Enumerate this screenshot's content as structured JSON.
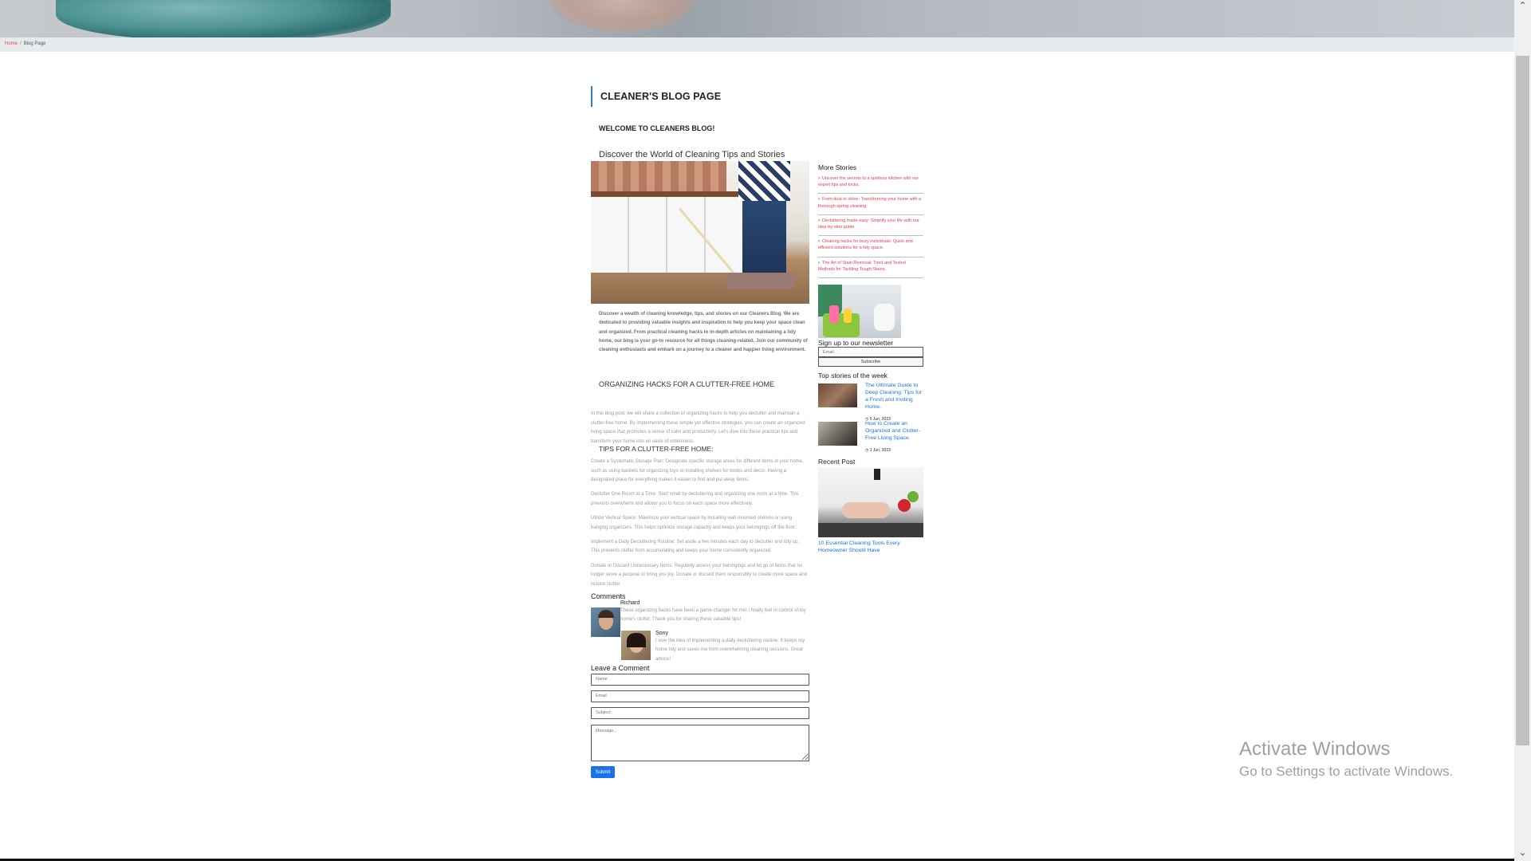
{
  "breadcrumb": {
    "home": "Home",
    "separator": "/",
    "current": "Blog Page"
  },
  "main": {
    "page_title": "CLEANER'S BLOG PAGE",
    "welcome": "WELCOME TO CLEANERS BLOG!",
    "discover": "Discover the World of Cleaning Tips and Stories",
    "intro": "Discover a wealth of cleaning knowledge, tips, and stories on our Cleaners Blog. We are dedicated to providing valuable insights and inspiration to help you keep your space clean and organized. From practical cleaning hacks to in-depth articles on maintaining a tidy home, our blog is your go-to resource for all things cleaning-related. Join our community of cleaning enthusiasts and embark on a journey to a cleaner and happier living environment.",
    "section_title": "ORGANIZING HACKS FOR A CLUTTER-FREE HOME",
    "post_intro": "In this blog post, we will share a collection of organizing hacks to help you declutter and maintain a clutter-free home. By implementing these simple yet effective strategies, you can create an organized living space that promotes a sense of calm and productivity. Let's dive into these practical tips and transform your home into an oasis of orderliness.",
    "tips_title": "TIPS FOR A CLUTTER-FREE HOME:",
    "tips": [
      "Create a Systematic Storage Plan: Designate specific storage areas for different items in your home, such as using baskets for organizing toys or installing shelves for books and decor. Having a designated place for everything makes it easier to find and put away items.",
      "Declutter One Room at a Time: Start small by decluttering and organizing one room at a time. This prevents overwhelm and allows you to focus on each space more effectively.",
      "Utilize Vertical Space: Maximize your vertical space by installing wall-mounted shelves or using hanging organizers. This helps optimize storage capacity and keeps your belongings off the floor.",
      "Implement a Daily Decluttering Routine: Set aside a few minutes each day to declutter and tidy up. This prevents clutter from accumulating and keeps your home consistently organized.",
      "Donate or Discard Unnecessary Items: Regularly assess your belongings and let go of items that no longer serve a purpose or bring you joy. Donate or discard them responsibly to create more space and reduce clutter."
    ],
    "comments_title": "Comments",
    "comments": [
      {
        "name": "Richard",
        "text": "These organizing hacks have been a game-changer for me! I finally feel in control of my home's clutter. Thank you for sharing these valuable tips!"
      },
      {
        "name": "Sony",
        "text": "I love the idea of implementing a daily decluttering routine. It keeps my home tidy and saves me from overwhelming cleaning sessions. Great advice!"
      }
    ],
    "leave_comment_title": "Leave a Comment",
    "form": {
      "name_placeholder": "Name",
      "email_placeholder": "Email",
      "subject_placeholder": "Subject",
      "message_placeholder": "Message...",
      "submit_label": "Submit"
    }
  },
  "sidebar": {
    "more_stories_title": "More Stories",
    "stories": [
      "Uncover the secrets to a spotless kitchen with our expert tips and tricks.",
      "From dust to shine: Transforming your home with a thorough spring cleaning.",
      "Decluttering made easy: Simplify your life with our step-by-step guide.",
      "Cleaning hacks for busy individuals: Quick and efficient solutions for a tidy space.",
      "The Art of Stain Removal: Tried and Tested Methods for Tackling Tough Stains."
    ],
    "newsletter_title": "Sign up to our newsletter",
    "newsletter_placeholder": "Email",
    "subscribe_label": "Subscribe",
    "top_stories_title": "Top stories of the week",
    "top_stories": [
      {
        "title": "The Ultimate Guide to Deep Cleaning: Tips for a Fresh and Inviting Home.",
        "date": "5 Jun, 2023"
      },
      {
        "title": "How to Create an Organized and Clutter-Free Living Space.",
        "date": "1 Jun, 2023"
      }
    ],
    "recent_post_title": "Recent Post",
    "recent_post": "10 Essential Cleaning Tools Every Homeowner Should Have"
  },
  "watermark": {
    "line1": "Activate Windows",
    "line2": "Go to Settings to activate Windows."
  },
  "icons": {
    "story_bullet": "chevron-right-icon",
    "date": "clock-icon"
  },
  "colors": {
    "accent": "#1a73e8",
    "story_link": "#e0414a",
    "breadcrumb_home": "#e24b4b"
  }
}
